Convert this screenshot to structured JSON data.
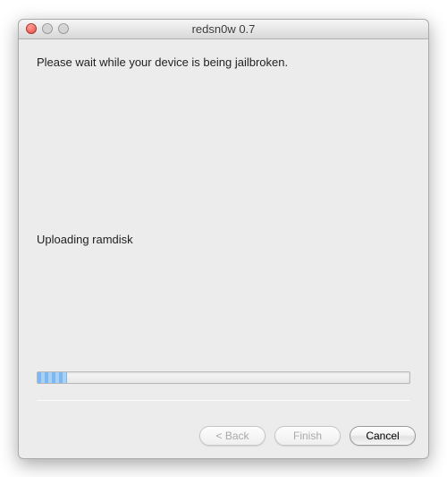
{
  "window": {
    "title": "redsn0w 0.7"
  },
  "content": {
    "instruction": "Please wait while your device is being jailbroken.",
    "status": "Uploading ramdisk"
  },
  "progress": {
    "percent": 8
  },
  "buttons": {
    "back_label": "< Back",
    "finish_label": "Finish",
    "cancel_label": "Cancel"
  }
}
